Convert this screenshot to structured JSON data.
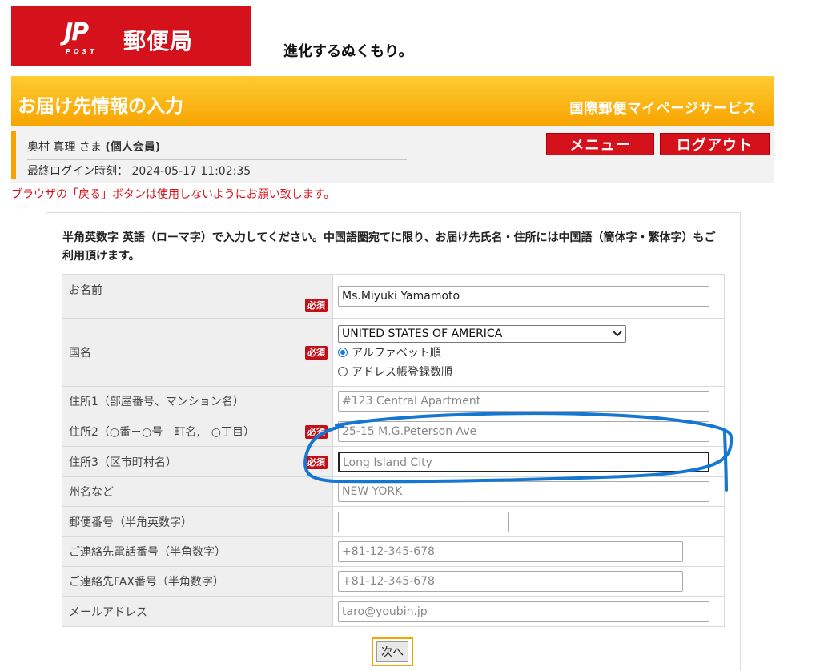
{
  "header": {
    "logo_mark": "JP",
    "logo_post": "POST",
    "logo_text": "郵便局",
    "tagline": "進化するぬくもり。"
  },
  "banner": {
    "title": "お届け先情報の入力",
    "service": "国際郵便マイページサービス"
  },
  "user": {
    "name": "奥村 真理 さま",
    "member_type": "(個人会員)",
    "last_login_label": "最終ログイン時刻：",
    "last_login_value": "2024-05-17 11:02:35"
  },
  "buttons": {
    "menu": "メニュー",
    "logout": "ログアウト",
    "next": "次へ"
  },
  "warning": "ブラウザの「戻る」ボタンは使用しないようにお願い致します。",
  "instructions": "半角英数字 英語（ローマ字）で入力してください。中国語圏宛てに限り、お届け先氏名・住所には中国語（簡体字・繁体字）もご利用頂けます。",
  "required_label": "必須",
  "form": {
    "name": {
      "label": "お名前",
      "value": "Ms.Miyuki Yamamoto"
    },
    "country": {
      "label": "国名",
      "selected": "UNITED STATES OF AMERICA",
      "radio_alpha": "アルファベット順",
      "radio_book": "アドレス帳登録数順"
    },
    "address1": {
      "label": "住所1（部屋番号、マンション名）",
      "placeholder": "#123 Central Apartment"
    },
    "address2": {
      "label": "住所2（○番－○号　町名,　○丁目）",
      "placeholder": "25-15 M.G.Peterson Ave"
    },
    "address3": {
      "label": "住所3（区市町村名）",
      "placeholder": "Long Island City"
    },
    "state": {
      "label": "州名など",
      "placeholder": "NEW YORK"
    },
    "postal": {
      "label": "郵便番号（半角英数字）",
      "value": ""
    },
    "phone": {
      "label": "ご連絡先電話番号（半角数字）",
      "placeholder": "+81-12-345-678"
    },
    "fax": {
      "label": "ご連絡先FAX番号（半角数字）",
      "placeholder": "+81-12-345-678"
    },
    "email": {
      "label": "メールアドレス",
      "placeholder": "taro@youbin.jp"
    }
  },
  "annotation_color": "#1677d2",
  "colors": {
    "brand_red": "#d5121b",
    "banner_orange": "#f7a400"
  }
}
